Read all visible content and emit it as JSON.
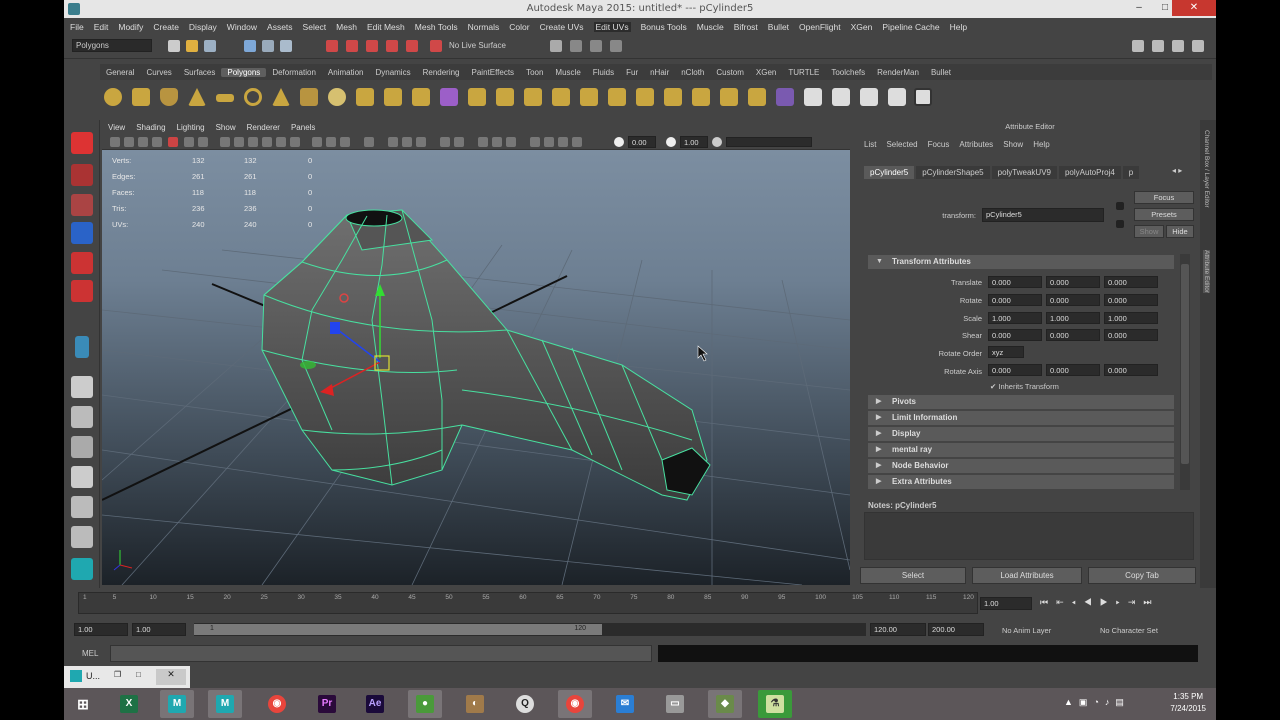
{
  "window": {
    "title": "Autodesk Maya 2015: untitled*   ---   pCylinder5",
    "minimize": "–",
    "maximize": "□",
    "close": "✕"
  },
  "menubar": [
    "File",
    "Edit",
    "Modify",
    "Create",
    "Display",
    "Window",
    "Assets",
    "Select",
    "Mesh",
    "Edit Mesh",
    "Mesh Tools",
    "Normals",
    "Color",
    "Create UVs",
    "Edit UVs",
    "Bonus Tools",
    "Muscle",
    "Bifrost",
    "Bullet",
    "OpenFlight",
    "XGen",
    "Pipeline Cache",
    "Help"
  ],
  "menubar_highlight_index": 14,
  "statusline": {
    "mode": "Polygons",
    "live": "No Live Surface"
  },
  "shelf_tabs": [
    "General",
    "Curves",
    "Surfaces",
    "Polygons",
    "Deformation",
    "Animation",
    "Dynamics",
    "Rendering",
    "PaintEffects",
    "Toon",
    "Muscle",
    "Fluids",
    "Fur",
    "nHair",
    "nCloth",
    "Custom",
    "XGen",
    "TURTLE",
    "Toolchefs",
    "RenderMan",
    "Bullet"
  ],
  "shelf_active": "Polygons",
  "panel_menu": [
    "View",
    "Shading",
    "Lighting",
    "Show",
    "Renderer",
    "Panels"
  ],
  "panel_tools": {
    "value1": "0.00",
    "value2": "1.00"
  },
  "hud": {
    "rows": [
      {
        "label": "Verts:",
        "a": "132",
        "b": "132",
        "c": "0"
      },
      {
        "label": "Edges:",
        "a": "261",
        "b": "261",
        "c": "0"
      },
      {
        "label": "Faces:",
        "a": "118",
        "b": "118",
        "c": "0"
      },
      {
        "label": "Tris:",
        "a": "236",
        "b": "236",
        "c": "0"
      },
      {
        "label": "UVs:",
        "a": "240",
        "b": "240",
        "c": "0"
      }
    ]
  },
  "attribute_editor": {
    "title": "Attribute Editor",
    "menu": [
      "List",
      "Selected",
      "Focus",
      "Attributes",
      "Show",
      "Help"
    ],
    "tabs": [
      "pCylinder5",
      "pCylinderShape5",
      "polyTweakUV9",
      "polyAutoProj4",
      "p"
    ],
    "transform_label": "transform:",
    "transform_value": "pCylinder5",
    "focus": "Focus",
    "presets": "Presets",
    "show": "Show",
    "hide": "Hide",
    "section_transform": "Transform Attributes",
    "translate": {
      "label": "Translate",
      "x": "0.000",
      "y": "0.000",
      "z": "0.000"
    },
    "rotate": {
      "label": "Rotate",
      "x": "0.000",
      "y": "0.000",
      "z": "0.000"
    },
    "scale": {
      "label": "Scale",
      "x": "1.000",
      "y": "1.000",
      "z": "1.000"
    },
    "shear": {
      "label": "Shear",
      "x": "0.000",
      "y": "0.000",
      "z": "0.000"
    },
    "rotate_order": {
      "label": "Rotate Order",
      "value": "xyz"
    },
    "rotate_axis": {
      "label": "Rotate Axis",
      "x": "0.000",
      "y": "0.000",
      "z": "0.000"
    },
    "inherits": "Inherits Transform",
    "sections": [
      "Pivots",
      "Limit Information",
      "Display",
      "mental ray",
      "Node Behavior",
      "Extra Attributes"
    ],
    "notes": "Notes:  pCylinder5",
    "btn_select": "Select",
    "btn_load": "Load Attributes",
    "btn_copy": "Copy Tab"
  },
  "right_strip": {
    "top": "Channel Box / Layer Editor",
    "bottom": "Attribute Editor"
  },
  "timeline": {
    "ticks": [
      "1",
      "5",
      "10",
      "15",
      "20",
      "25",
      "30",
      "35",
      "40",
      "45",
      "50",
      "55",
      "60",
      "65",
      "70",
      "75",
      "80",
      "85",
      "90",
      "95",
      "100",
      "105",
      "110",
      "115",
      "120"
    ],
    "current": "1.00"
  },
  "range": {
    "start": "1.00",
    "inner_start": "1.00",
    "slider_start": "1",
    "slider_end": "120",
    "end": "120.00",
    "outer_end": "200.00",
    "anim_layer": "No Anim Layer",
    "char_set": "No Character Set"
  },
  "cmdline": {
    "label": "MEL"
  },
  "mini_window": {
    "label": "U..."
  },
  "taskbar": {
    "time": "1:35 PM",
    "date": "7/24/2015"
  }
}
